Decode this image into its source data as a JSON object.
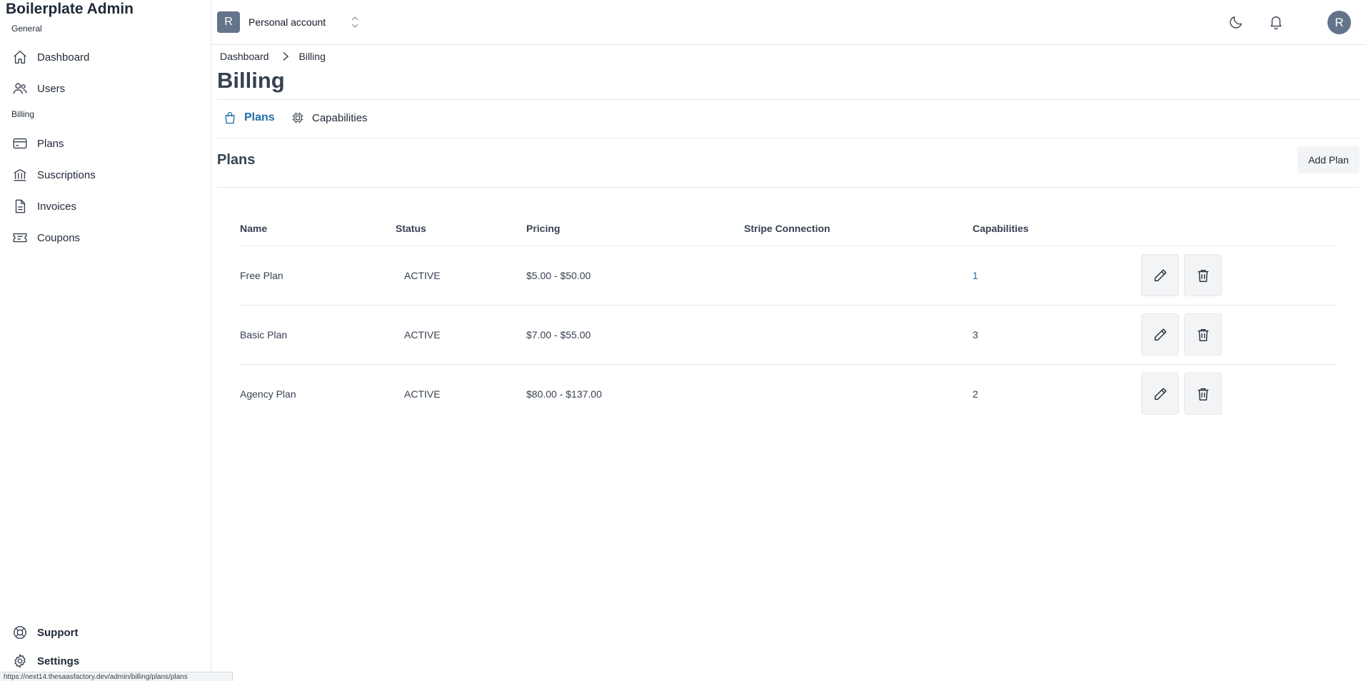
{
  "sidebar": {
    "brand": "Boilerplate Admin",
    "sections": {
      "general": "General",
      "billing": "Billing"
    },
    "items": {
      "dashboard": {
        "label": "Dashboard",
        "icon": "home-icon"
      },
      "users": {
        "label": "Users",
        "icon": "users-icon"
      },
      "plans": {
        "label": "Plans",
        "icon": "credit-card-icon"
      },
      "subscriptions": {
        "label": "Suscriptions",
        "icon": "bank-icon"
      },
      "invoices": {
        "label": "Invoices",
        "icon": "document-icon"
      },
      "coupons": {
        "label": "Coupons",
        "icon": "ticket-icon"
      },
      "support": {
        "label": "Support",
        "icon": "lifebuoy-icon"
      },
      "settings": {
        "label": "Settings",
        "icon": "gear-icon"
      }
    },
    "status_url": "https://next14.thesaasfactory.dev/admin/billing/plans/plans"
  },
  "topbar": {
    "account_initial": "R",
    "account_name": "Personal account",
    "user_initial": "R",
    "icons": [
      "moon-icon",
      "bell-icon"
    ]
  },
  "breadcrumb": {
    "items": [
      "Dashboard",
      "Billing"
    ]
  },
  "page": {
    "title": "Billing"
  },
  "tabs": [
    {
      "label": "Plans",
      "icon": "shopping-bag-icon",
      "active": true
    },
    {
      "label": "Capabilities",
      "icon": "chip-icon",
      "active": false
    }
  ],
  "section": {
    "title": "Plans",
    "add_button": "Add Plan"
  },
  "table": {
    "columns": [
      "Name",
      "Status",
      "Pricing",
      "Stripe Connection",
      "Capabilities"
    ],
    "rows": [
      {
        "name": "Free Plan",
        "status": "ACTIVE",
        "pricing": "$5.00 - $50.00",
        "stripe": "",
        "capabilities": "1"
      },
      {
        "name": "Basic Plan",
        "status": "ACTIVE",
        "pricing": "$7.00 - $55.00",
        "stripe": "",
        "capabilities": "3"
      },
      {
        "name": "Agency Plan",
        "status": "ACTIVE",
        "pricing": "$80.00 - $137.00",
        "stripe": "",
        "capabilities": "2"
      }
    ]
  },
  "colors": {
    "accent": "#1e6fa8",
    "avatar_bg": "#64748b"
  }
}
